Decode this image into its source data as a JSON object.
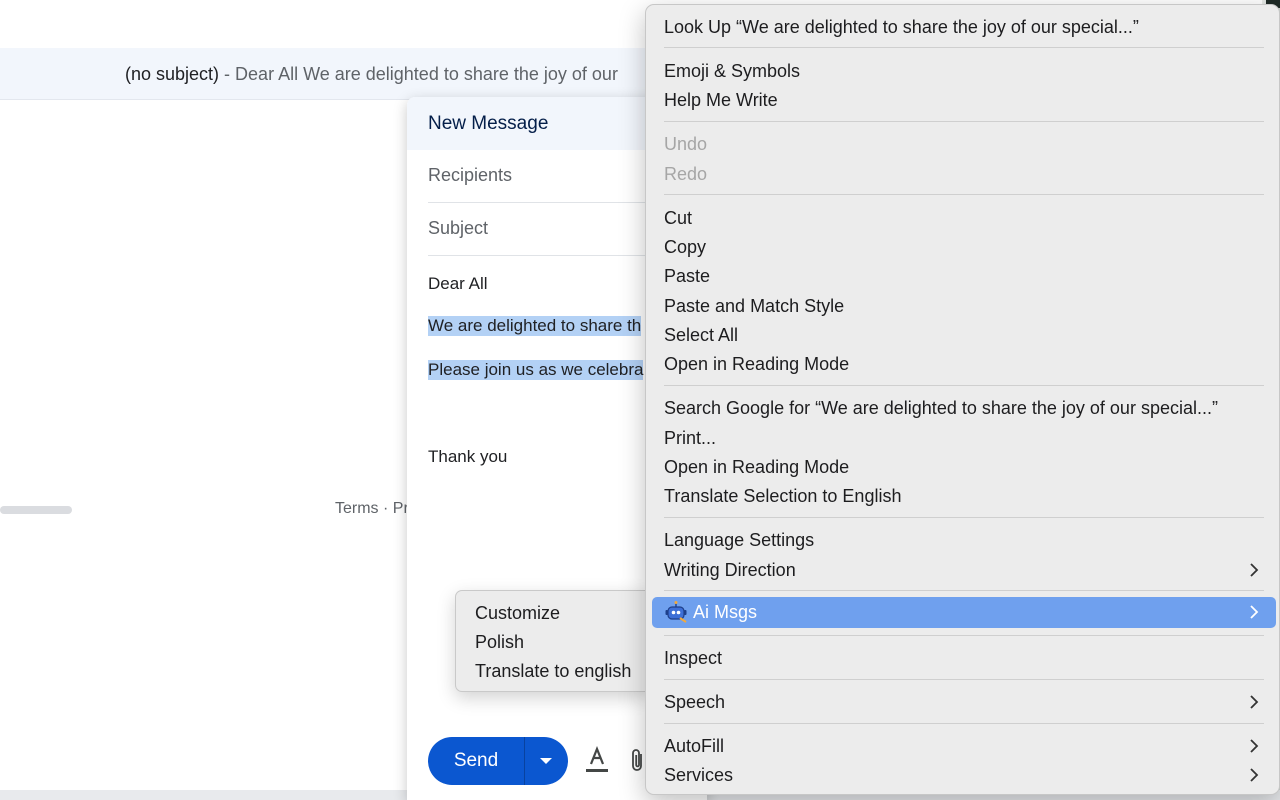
{
  "inbox": {
    "row_subject": "(no subject)",
    "row_separator": " - ",
    "row_snippet": "Dear All We are delighted to share the joy of our",
    "footer_links": "Terms · Pr"
  },
  "compose": {
    "title": "New Message",
    "recipients_placeholder": "Recipients",
    "subject_placeholder": "Subject",
    "body": {
      "greeting": "Dear All",
      "line1": "We are delighted to share th",
      "line2": "Please join us as we celebra",
      "closing": "Thank you"
    },
    "send_label": "Send"
  },
  "submenu": {
    "items": [
      "Customize",
      "Polish",
      "Translate to english"
    ]
  },
  "context_menu": {
    "look_up": "Look Up “We are delighted to share the joy of our special...”",
    "emoji": "Emoji & Symbols",
    "help_me_write": "Help Me Write",
    "undo": "Undo",
    "redo": "Redo",
    "cut": "Cut",
    "copy": "Copy",
    "paste": "Paste",
    "paste_match": "Paste and Match Style",
    "select_all": "Select All",
    "open_reading_1": "Open in Reading Mode",
    "search_google": "Search Google for “We are delighted to share the joy of our special...”",
    "print": "Print...",
    "open_reading_2": "Open in Reading Mode",
    "translate": "Translate Selection to English",
    "language_settings": "Language Settings",
    "writing_direction": "Writing Direction",
    "ai_msgs": "Ai Msgs",
    "inspect": "Inspect",
    "speech": "Speech",
    "autofill": "AutoFill",
    "services": "Services"
  },
  "colors": {
    "highlight": "#6fa0ee",
    "send_button": "#0b57d0",
    "selection": "#b3d1f5"
  },
  "icons": [
    "chevron-right-icon",
    "robot-icon",
    "text-format-icon",
    "attach-icon",
    "dropdown-caret-icon"
  ]
}
